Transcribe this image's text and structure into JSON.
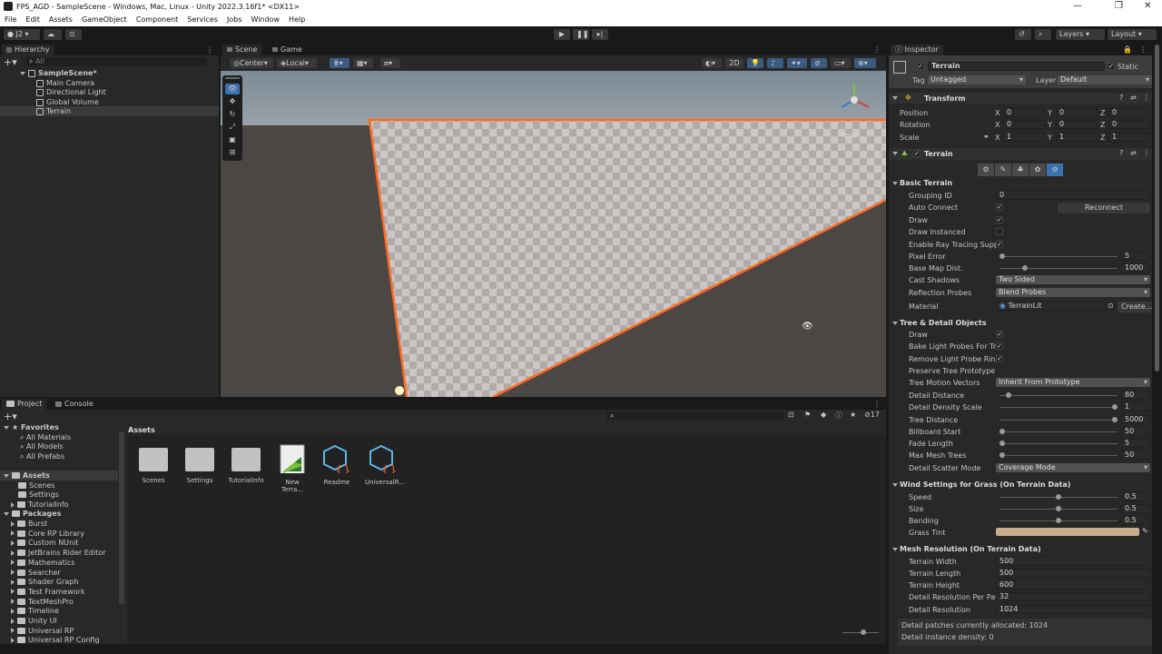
{
  "window": {
    "title": "FPS_AGD - SampleScene - Windows, Mac, Linux - Unity 2022.3.16f1* <DX11>"
  },
  "menu": [
    "File",
    "Edit",
    "Assets",
    "GameObject",
    "Component",
    "Services",
    "Jobs",
    "Window",
    "Help"
  ],
  "toolbar": {
    "account": "J2",
    "layers": "Layers",
    "layout": "Layout"
  },
  "hierarchy": {
    "tab": "Hierarchy",
    "search": "All",
    "scene": "SampleScene*",
    "items": [
      "Main Camera",
      "Directional Light",
      "Global Volume",
      "Terrain"
    ]
  },
  "scene_view": {
    "tabs": [
      "Scene",
      "Game"
    ],
    "pivot": "Center",
    "space": "Local",
    "mode_2d": "2D",
    "axis_label": "Persp"
  },
  "project": {
    "tabs": [
      "Project",
      "Console"
    ],
    "count": "17",
    "assets_title": "Assets",
    "favorites": {
      "label": "Favorites",
      "items": [
        "All Materials",
        "All Models",
        "All Prefabs"
      ]
    },
    "assets_tree": {
      "label": "Assets",
      "items": [
        "Scenes",
        "Settings",
        "TutorialInfo"
      ]
    },
    "packages": {
      "label": "Packages",
      "items": [
        "Burst",
        "Core RP Library",
        "Custom NUnit",
        "JetBrains Rider Editor",
        "Mathematics",
        "Searcher",
        "Shader Graph",
        "Test Framework",
        "TextMeshPro",
        "Timeline",
        "Unity UI",
        "Universal RP",
        "Universal RP Config"
      ]
    },
    "grid": [
      "Scenes",
      "Settings",
      "TutorialInfo",
      "New Terra...",
      "Readme",
      "UniversalR..."
    ]
  },
  "inspector": {
    "tab": "Inspector",
    "object": "Terrain",
    "static": "Static",
    "tag_label": "Tag",
    "tag": "Untagged",
    "layer_label": "Layer",
    "layer": "Default",
    "transform": {
      "title": "Transform",
      "position": "Position",
      "rotation": "Rotation",
      "scale": "Scale",
      "x": "X",
      "y": "Y",
      "z": "Z",
      "pos": [
        "0",
        "0",
        "0"
      ],
      "rot": [
        "0",
        "0",
        "0"
      ],
      "scl": [
        "1",
        "1",
        "1"
      ]
    },
    "terrain": {
      "title": "Terrain",
      "basic_title": "Basic Terrain",
      "grouping_id": "Grouping ID",
      "grouping_val": "0",
      "auto_connect": "Auto Connect",
      "reconnect": "Reconnect",
      "draw": "Draw",
      "draw_instanced": "Draw Instanced",
      "ray_tracing": "Enable Ray Tracing Supp",
      "pixel_error": "Pixel Error",
      "pixel_error_val": "5",
      "pixel_error_frac": 0.0,
      "base_map": "Base Map Dist.",
      "base_map_val": "1000",
      "base_map_frac": 0.2,
      "cast_shadows": "Cast Shadows",
      "cast_shadows_val": "Two Sided",
      "reflection": "Reflection Probes",
      "reflection_val": "Blend Probes",
      "material": "Material",
      "material_val": "TerrainLit",
      "create": "Create...",
      "tree_title": "Tree & Detail Objects",
      "tree_draw": "Draw",
      "bake_light": "Bake Light Probes For Tre",
      "remove_ring": "Remove Light Probe Ring",
      "preserve": "Preserve Tree Prototype L",
      "motion": "Tree Motion Vectors",
      "motion_val": "Inherit From Prototype",
      "detail_distance": "Detail Distance",
      "detail_distance_val": "80",
      "detail_distance_frac": 0.06,
      "detail_density": "Detail Density Scale",
      "detail_density_val": "1",
      "detail_density_frac": 1.0,
      "tree_distance": "Tree Distance",
      "tree_distance_val": "5000",
      "tree_distance_frac": 1.0,
      "billboard": "Billboard Start",
      "billboard_val": "50",
      "billboard_frac": 0.0,
      "fade": "Fade Length",
      "fade_val": "5",
      "fade_frac": 0.0,
      "max_mesh": "Max Mesh Trees",
      "max_mesh_val": "50",
      "max_mesh_frac": 0.0,
      "scatter": "Detail Scatter Mode",
      "scatter_val": "Coverage Mode",
      "wind_title": "Wind Settings for Grass (On Terrain Data)",
      "speed": "Speed",
      "speed_val": "0.5",
      "size": "Size",
      "size_val": "0.5",
      "bending": "Bending",
      "bending_val": "0.5",
      "wind_frac": 0.5,
      "grass_tint": "Grass Tint",
      "grass_tint_color": "#c8ad8c",
      "mesh_title": "Mesh Resolution (On Terrain Data)",
      "width": "Terrain Width",
      "width_val": "500",
      "length": "Terrain Length",
      "length_val": "500",
      "height": "Terrain Height",
      "height_val": "600",
      "detail_res_patch": "Detail Resolution Per Patc",
      "detail_res_patch_val": "32",
      "detail_res": "Detail Resolution",
      "detail_res_val": "1024",
      "info1": "Detail patches currently allocated: 1024",
      "info2": "Detail instance density: 0"
    }
  },
  "colors": {
    "selection": "#ff6a21",
    "accent": "#3a72b0"
  }
}
